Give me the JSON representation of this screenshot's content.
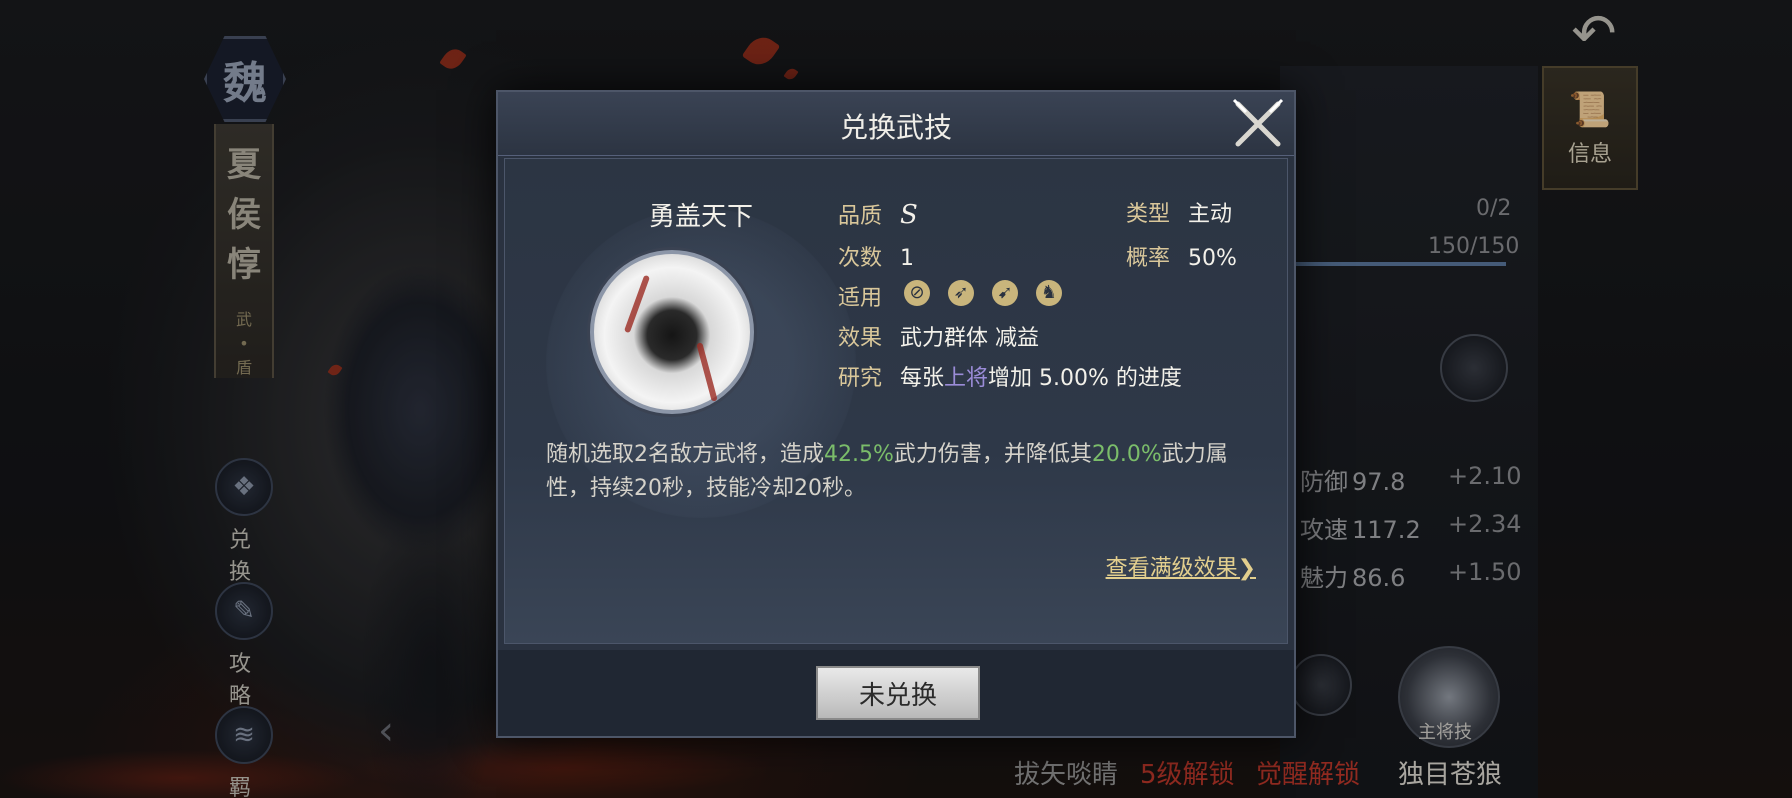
{
  "hero": {
    "faction": "魏",
    "name_chars": [
      "夏",
      "侯",
      "惇"
    ],
    "role": "武\n•\n盾"
  },
  "side_menu": {
    "exchange_label": "兑 换",
    "guide_label": "攻 略",
    "bond_label": "羁 绊"
  },
  "top_right": {
    "info_tab_label": "信息"
  },
  "right_panel": {
    "count_1": "0/2",
    "count_2": "150/150",
    "stats": [
      {
        "label": "防御",
        "value": "97.8",
        "delta": "+2.10"
      },
      {
        "label": "攻速",
        "value": "117.2",
        "delta": "+2.34"
      },
      {
        "label": "魅力",
        "value": "86.6",
        "delta": "+1.50"
      }
    ],
    "boss_skill_badge": "主将技",
    "bottom_labels": [
      {
        "text": "拔矢啖睛",
        "color": "#9a9a9a"
      },
      {
        "text": "5级解锁",
        "color": "#c0392b"
      },
      {
        "text": "觉醒解锁",
        "color": "#c0392b"
      },
      {
        "text": "独目苍狼",
        "color": "#e0ddd4"
      }
    ]
  },
  "dialog": {
    "title": "兑换武技",
    "skill_name": "勇盖天下",
    "fields": {
      "quality_label": "品质",
      "quality_value": "S",
      "count_label": "次数",
      "count_value": "1",
      "apply_label": "适用",
      "apply_icons": [
        "shield-icon",
        "bow-icon",
        "spear-icon",
        "horse-icon"
      ],
      "effect_label": "效果",
      "effect_value": "武力群体 减益",
      "research_label": "研究",
      "research_prefix": "每张",
      "research_highlight": "上将",
      "research_suffix": "增加 5.00% 的进度",
      "type_label": "类型",
      "type_value": "主动",
      "rate_label": "概率",
      "rate_value": "50%"
    },
    "description": {
      "part1": "随机选取2名敌方武将，造成",
      "pct1": "42.5%",
      "part2": "武力伤害，并降低其",
      "pct2": "20.0%",
      "part3": "武力属性，持续20秒，技能冷却20秒。"
    },
    "full_effect_link": "查看满级效果❯",
    "exchange_button": "未兑换"
  },
  "colors": {
    "accent_gold": "#d9c79a",
    "highlight_green": "#7bbd6a",
    "highlight_purple": "#9b8cd8",
    "unlock_red": "#c0392b"
  }
}
